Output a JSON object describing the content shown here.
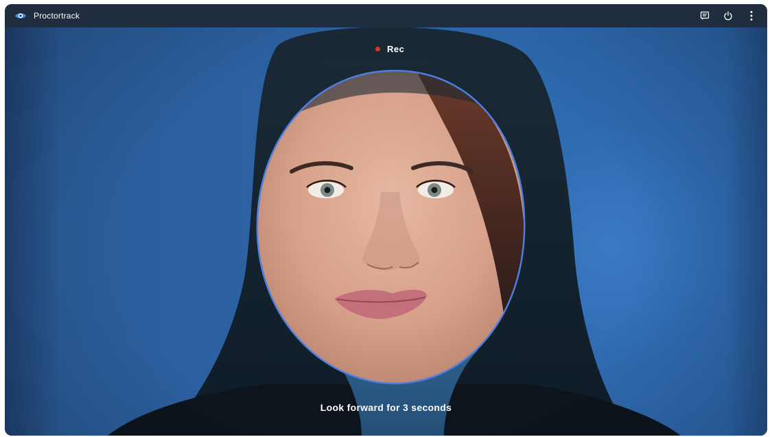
{
  "window": {
    "title": "Proctortrack",
    "logo_icon": "proctortrack-eye-logo-icon",
    "actions": [
      {
        "name": "chat-icon"
      },
      {
        "name": "power-icon"
      },
      {
        "name": "more-vertical-icon"
      }
    ]
  },
  "camera": {
    "recording_label": "Rec",
    "recording_color": "#e0342e",
    "face_guide_color": "#4d7fe0",
    "instruction": "Look forward for 3 seconds"
  },
  "colors": {
    "titlebar": "#1f2d3f",
    "background": "#2f6ab0"
  }
}
